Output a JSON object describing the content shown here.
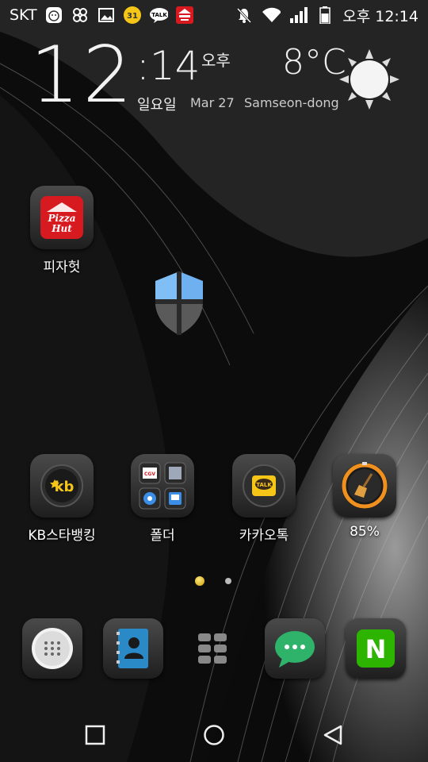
{
  "status_bar": {
    "carrier": "SKT",
    "time": "오후 12:14",
    "notification_icons": [
      "baby-app-icon",
      "clover-icon",
      "gallery-icon",
      "baskin-robbins-icon",
      "kakaotalk-icon",
      "pizza-hut-icon"
    ],
    "status_icons": [
      "mute-icon",
      "wifi-icon",
      "signal-icon",
      "battery-icon"
    ],
    "talk_badge": "TALK",
    "br_badge": "31"
  },
  "clock_widget": {
    "hour": "12",
    "minute": ":14",
    "ampm": "오후",
    "temperature": "8°C",
    "day": "일요일",
    "date": "Mar 27",
    "location": "Samseon-dong",
    "weather_icon": "sun-icon"
  },
  "home_apps": [
    {
      "label": "피자헛",
      "icon": "pizza-hut-icon",
      "logo_text_1": "Pizza",
      "logo_text_2": "Hut"
    },
    {
      "label": "KB스타뱅킹",
      "icon": "kb-star-banking-icon",
      "logo_text": "kb"
    },
    {
      "label": "폴더",
      "icon": "folder-icon",
      "mini_text": "CGV"
    },
    {
      "label": "카카오톡",
      "icon": "kakaotalk-icon",
      "logo_text": "TALK"
    },
    {
      "label": "85%",
      "icon": "cleaner-broom-icon"
    }
  ],
  "page_indicator": {
    "pages": 2,
    "current": 1
  },
  "dock": [
    {
      "icon": "phone-dialer-icon"
    },
    {
      "icon": "contacts-icon"
    },
    {
      "icon": "app-drawer-icon"
    },
    {
      "icon": "messages-icon"
    },
    {
      "icon": "naver-icon",
      "logo_text": "N"
    }
  ],
  "nav_bar": {
    "buttons": [
      "recent-apps-icon",
      "home-icon",
      "back-icon"
    ]
  },
  "colors": {
    "accent_yellow": "#f5c518",
    "naver_green": "#2db400",
    "pizza_red": "#d71920",
    "shield_blue": "#6fb0f0"
  }
}
